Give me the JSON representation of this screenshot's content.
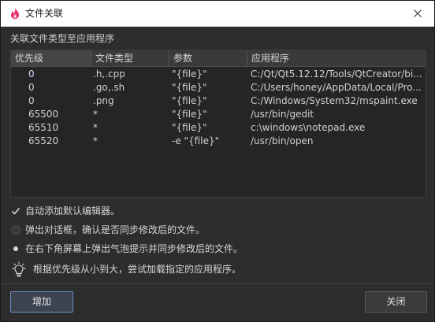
{
  "window": {
    "title": "文件关联"
  },
  "group_label": "关联文件类型至应用程序",
  "table": {
    "headers": [
      "优先级",
      "文件类型",
      "参数",
      "应用程序"
    ],
    "rows": [
      [
        "0",
        ".h,.cpp",
        "\"{file}\"",
        "C:/Qt/Qt5.12.12/Tools/QtCreator/bi..."
      ],
      [
        "0",
        ".go,.sh",
        "\"{file}\"",
        "C:/Users/honey/AppData/Local/Pro..."
      ],
      [
        "0",
        ".png",
        "\"{file}\"",
        "C:/Windows/System32/mspaint.exe"
      ],
      [
        "65500",
        "*",
        "\"{file}\"",
        "/usr/bin/gedit"
      ],
      [
        "65510",
        "*",
        "\"{file}\"",
        "c:\\windows\\notepad.exe"
      ],
      [
        "65520",
        "*",
        "-e \"{file}\"",
        "/usr/bin/open"
      ]
    ]
  },
  "options": {
    "auto_add_default_editor": {
      "label": "自动添加默认编辑器。",
      "checked": true
    },
    "popup_dialog": {
      "label": "弹出对话框，确认是否同步修改后的文件。",
      "selected": false
    },
    "bubble_tip": {
      "label": "在右下角屏幕上弹出气泡提示并同步修改后的文件。",
      "selected": true
    }
  },
  "tip": {
    "text": "根据优先级从小到大，尝试加载指定的应用程序。"
  },
  "buttons": {
    "add": "增加",
    "close": "关闭"
  },
  "colors": {
    "accent": "#6d8fbf",
    "app_icon": "#e8326c"
  }
}
